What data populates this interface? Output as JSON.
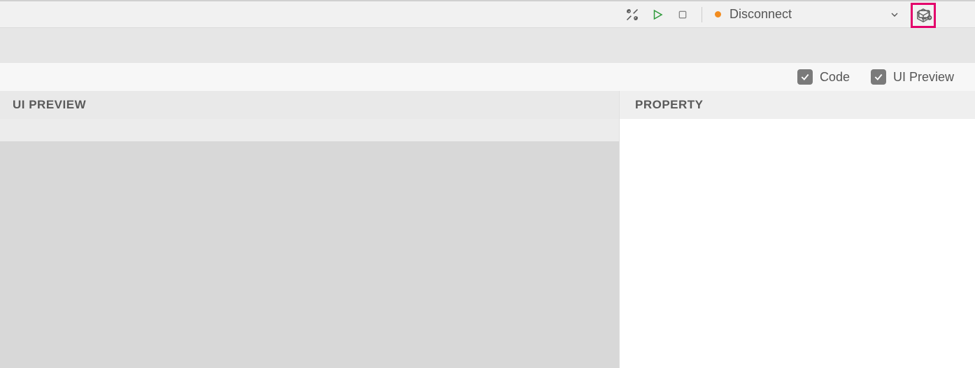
{
  "toolbar": {
    "status_label": "Disconnect",
    "status_color": "#f28c1f"
  },
  "options": {
    "code_label": "Code",
    "code_checked": true,
    "ui_preview_label": "UI Preview",
    "ui_preview_checked": true
  },
  "panels": {
    "preview_header": "UI PREVIEW",
    "property_header": "PROPERTY"
  }
}
